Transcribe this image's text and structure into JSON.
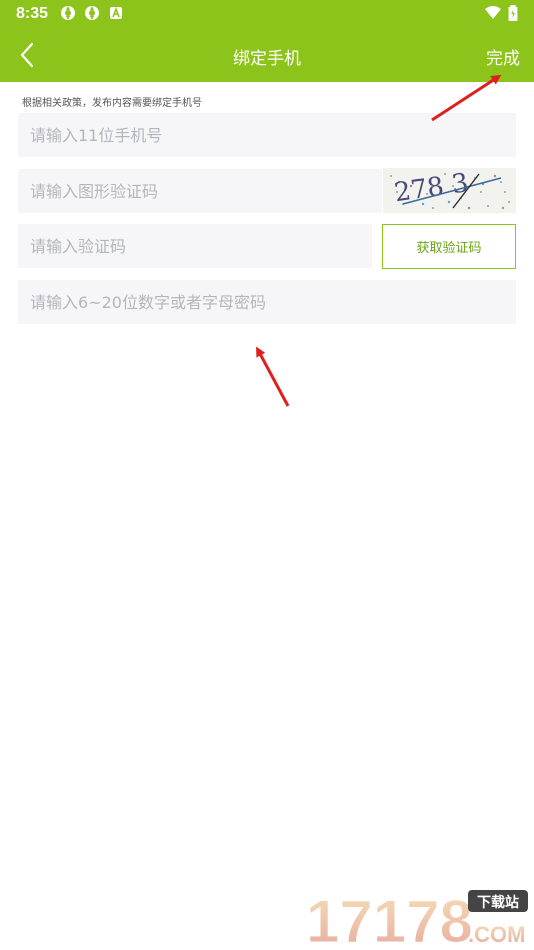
{
  "status_bar": {
    "time": "8:35",
    "icons": [
      "sync-icon",
      "sync-icon",
      "font-a-icon",
      "wifi-icon",
      "battery-icon"
    ]
  },
  "app_bar": {
    "title": "绑定手机",
    "done_label": "完成",
    "back_icon": "chevron-left-icon",
    "bg_color": "#8dc41c"
  },
  "form": {
    "hint": "根据相关政策，发布内容需要绑定手机号",
    "phone_placeholder": "请输入11位手机号",
    "captcha_placeholder": "请输入图形验证码",
    "captcha_image_text": "278 3",
    "code_placeholder": "请输入验证码",
    "get_code_label": "获取验证码",
    "password_placeholder": "请输入6~20位数字或者字母密码"
  },
  "watermark": {
    "number": "17178",
    "badge": "下载站",
    "domain": ".COM"
  }
}
